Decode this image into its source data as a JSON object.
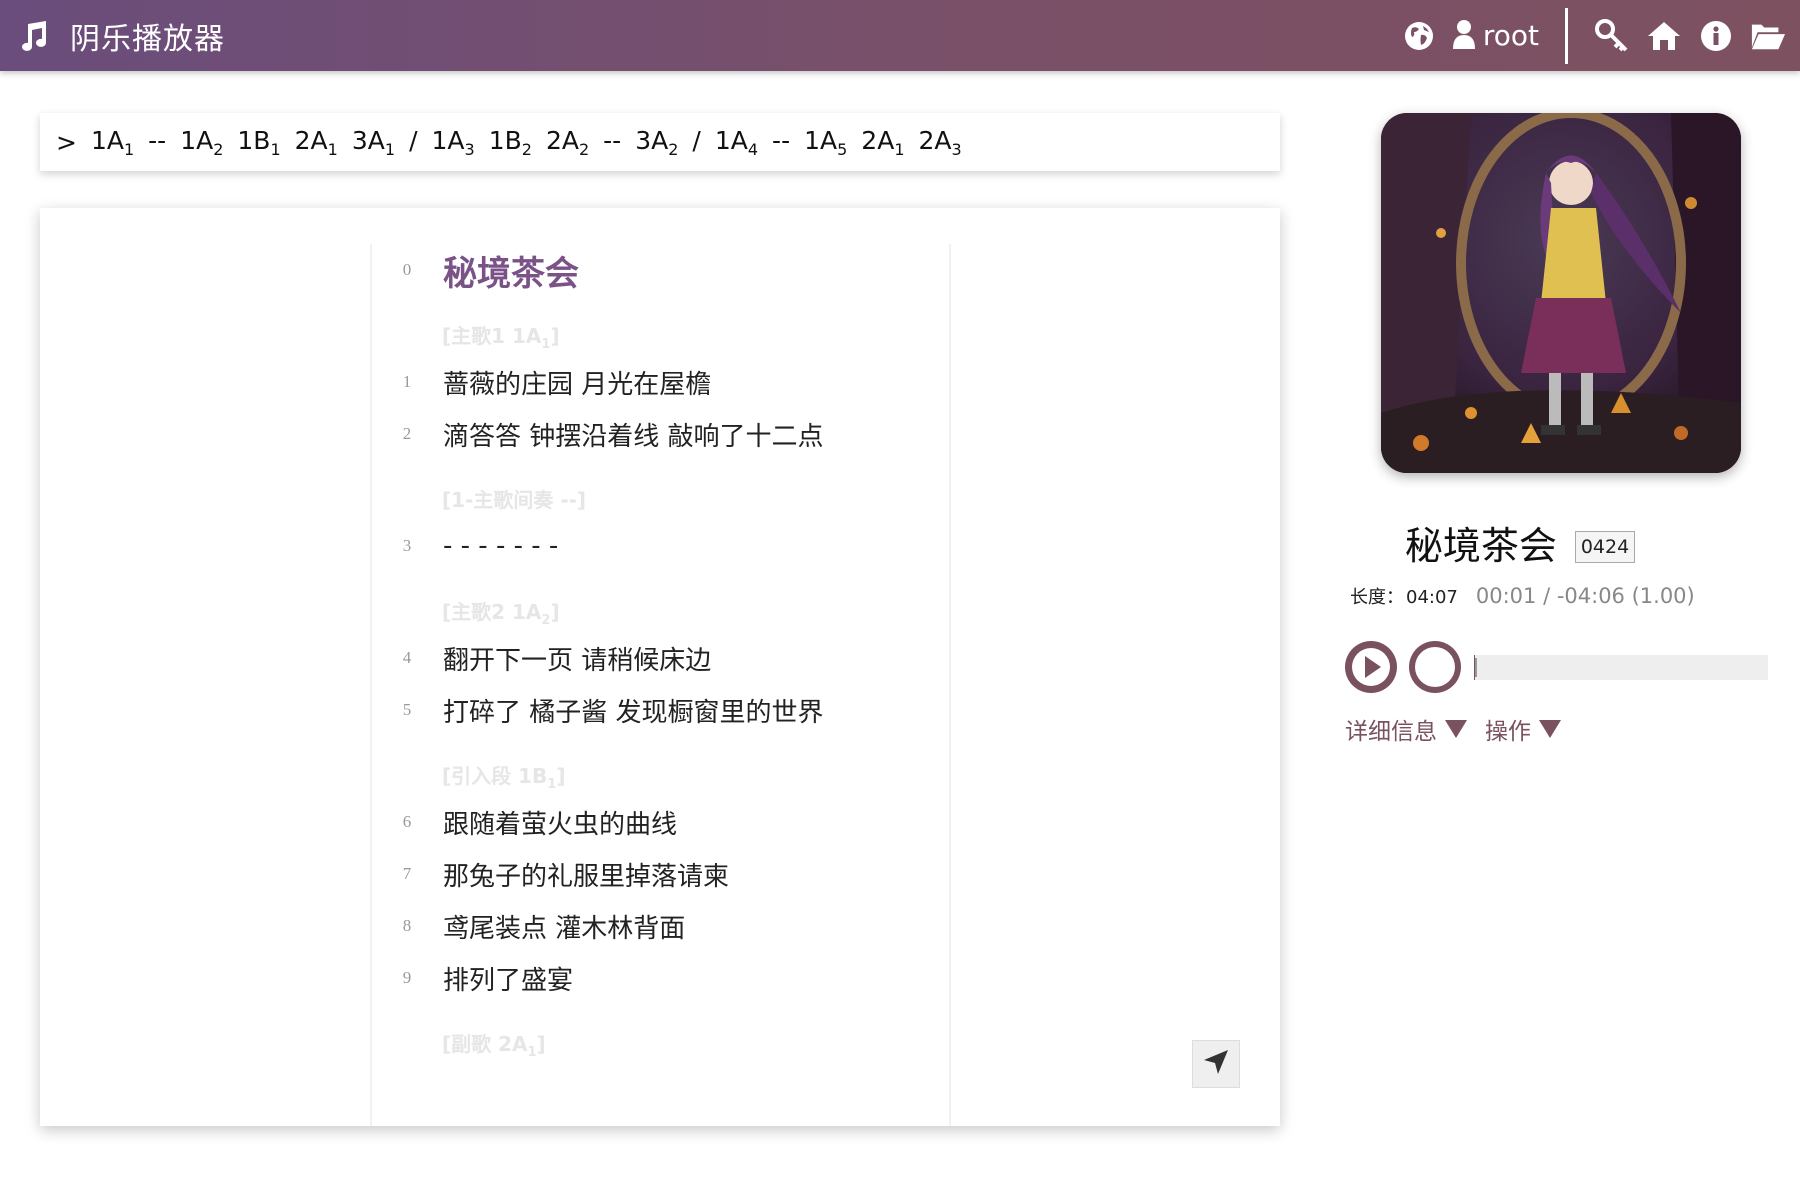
{
  "header": {
    "title": "阴乐播放器",
    "username": "root",
    "icons": [
      "music-note-icon",
      "globe-icon",
      "user-icon",
      "key-icon",
      "home-icon",
      "info-icon",
      "folder-open-icon"
    ]
  },
  "structure": {
    "prefix": ">",
    "groups": [
      [
        {
          "base": "1A",
          "sub": "1"
        },
        {
          "sep": "--"
        },
        {
          "base": "1A",
          "sub": "2"
        },
        {
          "base": "1B",
          "sub": "1"
        },
        {
          "base": "2A",
          "sub": "1"
        },
        {
          "base": "3A",
          "sub": "1"
        }
      ],
      [
        {
          "base": "1A",
          "sub": "3"
        },
        {
          "base": "1B",
          "sub": "2"
        },
        {
          "base": "2A",
          "sub": "2"
        },
        {
          "sep": "--"
        },
        {
          "base": "3A",
          "sub": "2"
        }
      ],
      [
        {
          "base": "1A",
          "sub": "4"
        },
        {
          "sep": "--"
        },
        {
          "base": "1A",
          "sub": "5"
        },
        {
          "base": "2A",
          "sub": "1"
        },
        {
          "base": "2A",
          "sub": "3"
        }
      ]
    ],
    "group_separator": "/"
  },
  "lyrics": {
    "title_line": {
      "num": "0",
      "text": "秘境茶会"
    },
    "rows": [
      {
        "type": "section",
        "label": "[主歌1 1A",
        "sub": "1",
        "end": "]"
      },
      {
        "type": "line",
        "num": "1",
        "text": "蔷薇的庄园 月光在屋檐"
      },
      {
        "type": "line",
        "num": "2",
        "text": "滴答答 钟摆沿着线 敲响了十二点"
      },
      {
        "type": "section",
        "label": "[1-主歌间奏 --]",
        "sub": "",
        "end": ""
      },
      {
        "type": "line",
        "num": "3",
        "text": "- - - - - - -"
      },
      {
        "type": "section",
        "label": "[主歌2 1A",
        "sub": "2",
        "end": "]"
      },
      {
        "type": "line",
        "num": "4",
        "text": "翻开下一页 请稍候床边"
      },
      {
        "type": "line",
        "num": "5",
        "text": "打碎了 橘子酱 发现橱窗里的世界"
      },
      {
        "type": "section",
        "label": "[引入段 1B",
        "sub": "1",
        "end": "]"
      },
      {
        "type": "line",
        "num": "6",
        "text": "跟随着萤火虫的曲线"
      },
      {
        "type": "line",
        "num": "7",
        "text": "那兔子的礼服里掉落请柬"
      },
      {
        "type": "line",
        "num": "8",
        "text": "鸢尾装点 灌木林背面"
      },
      {
        "type": "line",
        "num": "9",
        "text": "排列了盛宴"
      },
      {
        "type": "section",
        "label": "[副歌 2A",
        "sub": "1",
        "end": "]"
      }
    ]
  },
  "player": {
    "song_title": "秘境茶会",
    "song_id": "0424",
    "length_label": "长度：",
    "length_value": "04:07",
    "time_display": "00:01 / -04:06 (1.00)",
    "progress_fraction": 0.004,
    "details_label": "详细信息",
    "actions_label": "操作"
  },
  "colors": {
    "header_start": "#6a4d7c",
    "header_end": "#7d5160",
    "accent": "#7a5160",
    "title_purple": "#7a5288"
  }
}
